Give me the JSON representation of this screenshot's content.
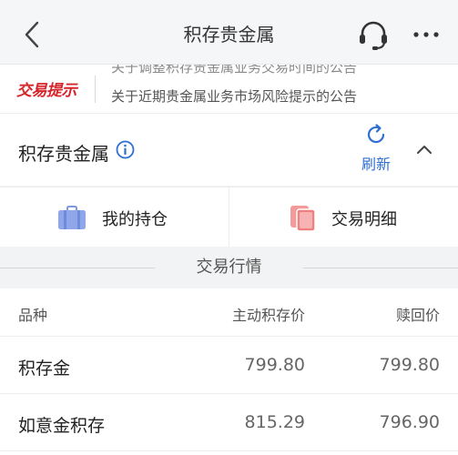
{
  "navbar": {
    "title": "积存贵金属",
    "back_icon": "chevron-left-icon",
    "service_icon": "headset-icon",
    "more_icon": "more-dots-icon"
  },
  "notice": {
    "logo": "交易提示",
    "text_top": "关于调整积存贵金属业务交易时间的公告",
    "text": "关于近期贵金属业务市场风险提示的公告"
  },
  "account": {
    "title": "积存贵金属",
    "info_icon": "info-circle-icon",
    "refresh_label": "刷新",
    "refresh_icon": "refresh-icon",
    "collapse_icon": "chevron-up-icon"
  },
  "actions": {
    "holdings": {
      "label": "我的持仓",
      "icon": "briefcase-icon"
    },
    "details": {
      "label": "交易明细",
      "icon": "documents-icon"
    }
  },
  "market": {
    "title": "交易行情",
    "headers": [
      "品种",
      "主动积存价",
      "赎回价"
    ],
    "rows": [
      {
        "name": "积存金",
        "buy": "799.80",
        "redeem": "799.80"
      },
      {
        "name": "如意金积存",
        "buy": "815.29",
        "redeem": "796.90"
      }
    ]
  },
  "colors": {
    "accent_blue": "#2f6fd1",
    "notice_red": "#d6242b",
    "briefcase": "#8fa6e8",
    "documents": "#f07f7f"
  }
}
